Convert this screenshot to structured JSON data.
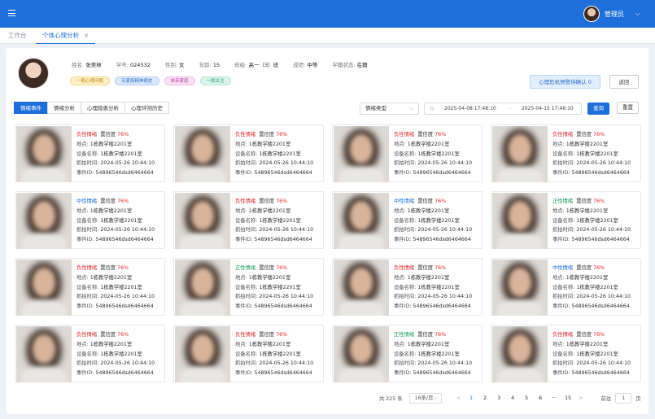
{
  "header": {
    "user_name": "管理员",
    "chevron": "⌵"
  },
  "tabs": [
    {
      "label": "工作台"
    },
    {
      "label": "个体心理分析",
      "close": "×"
    }
  ],
  "profile": {
    "fields": [
      {
        "k": "姓名: ",
        "v": "张美林"
      },
      {
        "k": "学号: ",
        "v": "024532"
      },
      {
        "k": "性别: ",
        "v": "女"
      },
      {
        "k": "年龄: ",
        "v": "15"
      },
      {
        "k": "班级: ",
        "v": "高一（3）班"
      },
      {
        "k": "成绩: ",
        "v": "中等"
      },
      {
        "k": "学籍状态: ",
        "v": "在籍"
      }
    ],
    "tags": [
      "一般心理问题",
      "无家族精神病史",
      "单亲家庭",
      "一般关注"
    ],
    "crisis_button": "心理危机预警待确认 0",
    "back_button": "返回"
  },
  "filters": {
    "segments": [
      "情绪事件",
      "情绪分析",
      "心理隐患分析",
      "心理评测历史"
    ],
    "type_select": "情绪类型",
    "arrow": "⌵",
    "calendar_icon": "◷",
    "date_start": "2025-04-08 17:48:10",
    "date_sep": "-",
    "date_end": "2025-04-15 17:48:10",
    "query_button": "查询",
    "reset_button": "重置"
  },
  "event_labels": {
    "confidence": "置信度 ",
    "location": "地点: ",
    "device": "设备名称: ",
    "time": "抓拍时间: ",
    "event_id": "事件ID: "
  },
  "events": [
    {
      "emotion": "负性情绪",
      "tone": "neg",
      "confidence": "76%",
      "location": "1栋教学楼2201室",
      "device": "1栋教学楼2201室",
      "time": "2024-05-26 10:44:10",
      "id": "54896546dsd6464664"
    },
    {
      "emotion": "负性情绪",
      "tone": "neg",
      "confidence": "76%",
      "location": "1栋教学楼2201室",
      "device": "1栋教学楼2201室",
      "time": "2024-05-26 10:44:10",
      "id": "54896546dsd6464664"
    },
    {
      "emotion": "负性情绪",
      "tone": "neg",
      "confidence": "76%",
      "location": "1栋教学楼2201室",
      "device": "1栋教学楼2201室",
      "time": "2024-05-26 10:44:10",
      "id": "54896546dsd6464664"
    },
    {
      "emotion": "负性情绪",
      "tone": "neg",
      "confidence": "76%",
      "location": "1栋教学楼2201室",
      "device": "1栋教学楼2201室",
      "time": "2024-05-26 10:44:10",
      "id": "54896546dsd6464664"
    },
    {
      "emotion": "中性情绪",
      "tone": "neu",
      "confidence": "76%",
      "location": "1栋教学楼2201室",
      "device": "1栋教学楼2201室",
      "time": "2024-05-26 10:44:10",
      "id": "54896546dsd6464664"
    },
    {
      "emotion": "负性情绪",
      "tone": "neg",
      "confidence": "76%",
      "location": "1栋教学楼2201室",
      "device": "1栋教学楼2201室",
      "time": "2024-05-26 10:44:10",
      "id": "54896546dsd6464664"
    },
    {
      "emotion": "中性情绪",
      "tone": "neu",
      "confidence": "76%",
      "location": "1栋教学楼2201室",
      "device": "1栋教学楼2201室",
      "time": "2024-05-26 10:44:10",
      "id": "54896546dsd6464664"
    },
    {
      "emotion": "正性情绪",
      "tone": "pos",
      "confidence": "76%",
      "location": "1栋教学楼2201室",
      "device": "1栋教学楼2201室",
      "time": "2024-05-26 10:44:10",
      "id": "54896546dsd6464664"
    },
    {
      "emotion": "负性情绪",
      "tone": "neg",
      "confidence": "76%",
      "location": "1栋教学楼2201室",
      "device": "1栋教学楼2201室",
      "time": "2024-05-26 10:44:10",
      "id": "54896546dsd6464664"
    },
    {
      "emotion": "正性情绪",
      "tone": "pos",
      "confidence": "76%",
      "location": "1栋教学楼2201室",
      "device": "1栋教学楼2201室",
      "time": "2024-05-26 10:44:10",
      "id": "54896546dsd6464664"
    },
    {
      "emotion": "负性情绪",
      "tone": "neg",
      "confidence": "76%",
      "location": "1栋教学楼2201室",
      "device": "1栋教学楼2201室",
      "time": "2024-05-26 10:44:10",
      "id": "54896546dsd6464664"
    },
    {
      "emotion": "中性情绪",
      "tone": "neu",
      "confidence": "76%",
      "location": "1栋教学楼2201室",
      "device": "1栋教学楼2201室",
      "time": "2024-05-26 10:44:10",
      "id": "54896546dsd6464664"
    },
    {
      "emotion": "负性情绪",
      "tone": "neg",
      "confidence": "76%",
      "location": "1栋教学楼2201室",
      "device": "1栋教学楼2201室",
      "time": "2024-05-26 10:44:10",
      "id": "54896546dsd6464664"
    },
    {
      "emotion": "负性情绪",
      "tone": "neg",
      "confidence": "76%",
      "location": "1栋教学楼2201室",
      "device": "1栋教学楼2201室",
      "time": "2024-05-26 10:44:10",
      "id": "54896546dsd6464664"
    },
    {
      "emotion": "正性情绪",
      "tone": "pos",
      "confidence": "76%",
      "location": "1栋教学楼2201室",
      "device": "1栋教学楼2201室",
      "time": "2024-05-26 10:44:10",
      "id": "54896546dsd6464664"
    },
    {
      "emotion": "负性情绪",
      "tone": "neg",
      "confidence": "76%",
      "location": "1栋教学楼2201室",
      "device": "1栋教学楼2201室",
      "time": "2024-05-26 10:44:10",
      "id": "54896546dsd6464664"
    }
  ],
  "pagination": {
    "total": "共 225 条",
    "page_size": "16条/页",
    "prev": "<",
    "next": ">",
    "pages": [
      "1",
      "2",
      "3",
      "4",
      "5",
      "6",
      "···",
      "15"
    ],
    "current": "1",
    "goto_label": "前往",
    "goto_value": "1",
    "page_unit": "页"
  }
}
